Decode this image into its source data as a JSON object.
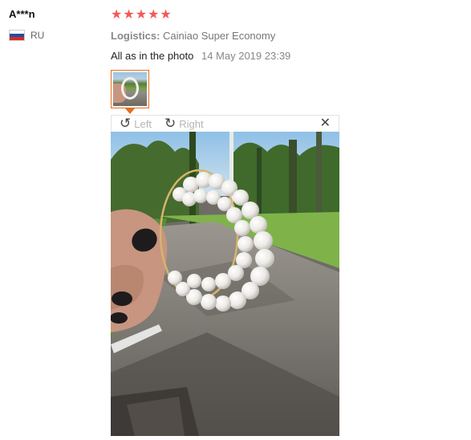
{
  "review": {
    "user_name": "A***n",
    "country_code": "RU",
    "rating_stars": 5,
    "logistics_label": "Logistics:",
    "logistics_value": "Cainiao Super Economy",
    "comment": "All as in the photo",
    "date": "14 May 2019 23:39"
  },
  "viewer": {
    "rotate_left_label": "Left",
    "rotate_right_label": "Right"
  },
  "colors": {
    "star": "#f45858",
    "thumb_border": "#e36e1f"
  },
  "icons": {
    "rotate_left": "rotate-left-icon",
    "rotate_right": "rotate-right-icon",
    "close": "close-icon",
    "star": "star-icon",
    "flag": "russia-flag-icon"
  }
}
